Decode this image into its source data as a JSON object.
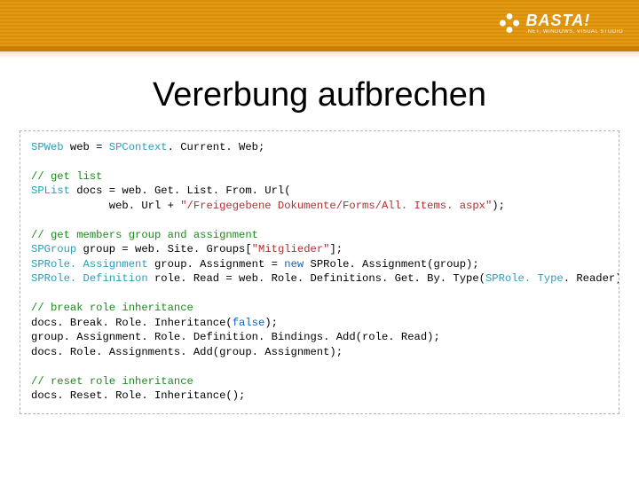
{
  "header": {
    "logo_main": "BASTA!",
    "logo_sub": ".NET, WINDOWS, VISUAL STUDIO"
  },
  "title": "Vererbung aufbrechen",
  "code": {
    "line1_type": "SPWeb",
    "line1_rest": " web = ",
    "line1_type2": "SPContext",
    "line1_rest2": ". Current. Web;",
    "c1": "// get list",
    "line2_type": "SPList",
    "line2_rest": " docs = web. Get. List. From. Url(",
    "line3_a": "            web. Url + ",
    "line3_str": "\"/Freigegebene Dokumente/Forms/All. Items. aspx\"",
    "line3_b": ");",
    "c2": "// get members group and assignment",
    "line4_type": "SPGroup",
    "line4_rest_a": " group = web. Site. Groups[",
    "line4_str": "\"Mitglieder\"",
    "line4_rest_b": "];",
    "line5_type": "SPRole. Assignment",
    "line5_rest_a": " group. Assignment = ",
    "line5_kw": "new",
    "line5_rest_b": " SPRole. Assignment(group);",
    "line6_type": "SPRole. Definition",
    "line6_rest_a": " role. Read = web. Role. Definitions. Get. By. Type(",
    "line6_type2": "SPRole. Type",
    "line6_rest_b": ". Reader);",
    "c3": "// break role inheritance",
    "line7_a": "docs. Break. Role. Inheritance(",
    "line7_kw": "false",
    "line7_b": ");",
    "line8": "group. Assignment. Role. Definition. Bindings. Add(role. Read);",
    "line9": "docs. Role. Assignments. Add(group. Assignment);",
    "c4": "// reset role inheritance",
    "line10": "docs. Reset. Role. Inheritance();"
  }
}
